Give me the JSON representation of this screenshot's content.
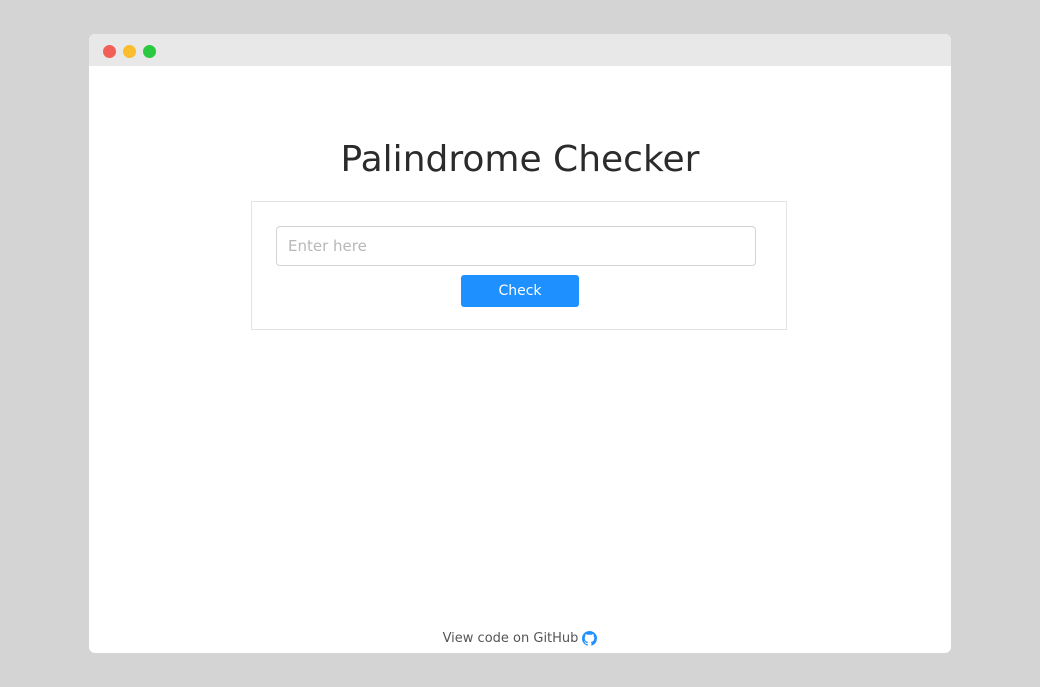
{
  "window": {
    "controls": {
      "close_color": "#f25f57",
      "minimize_color": "#fbbc2e",
      "maximize_color": "#2ac93f"
    }
  },
  "main": {
    "title": "Palindrome Checker",
    "input": {
      "value": "",
      "placeholder": "Enter here"
    },
    "check_button": {
      "label": "Check",
      "color": "#1e90ff"
    }
  },
  "footer": {
    "link_text": "View code on GitHub",
    "icon": "github-icon",
    "icon_color": "#1e90ff"
  }
}
